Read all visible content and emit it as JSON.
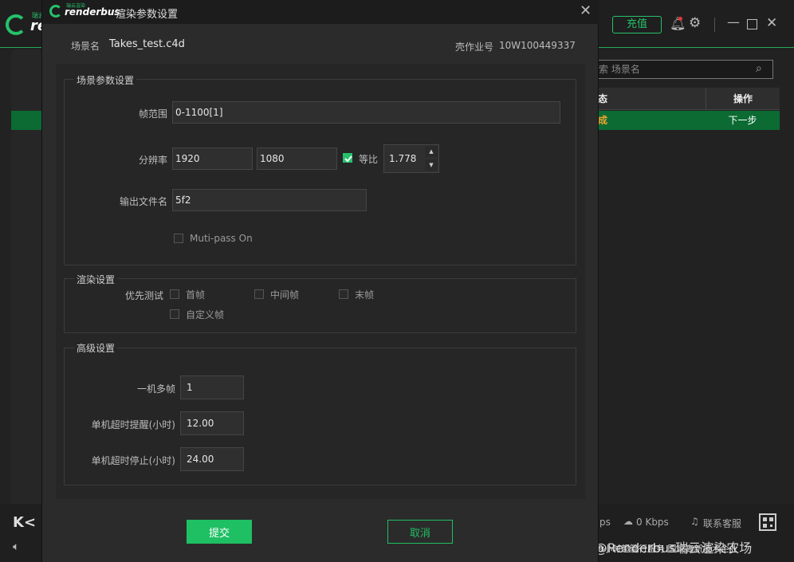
{
  "background_app": {
    "logo_small": "瑞云渲染",
    "logo_text": "re",
    "recharge_label": "充值",
    "search_placeholder": "索 场景名",
    "table_headers": [
      "态",
      "操作"
    ],
    "row": {
      "status": "成",
      "action": "下一步"
    },
    "status_bar": {
      "ps": "ps",
      "kbps": "0 Kbps",
      "support": "联系客服"
    },
    "footer_text": "9小时超管行服务 国家高新技术企业"
  },
  "watermark": "CSDN @Renderbus瑞云渲染农场",
  "dialog": {
    "brand_small": "瑞云渲染",
    "brand": "renderbus",
    "title": "渲染参数设置",
    "close_glyph": "✕",
    "scene_label": "场景名",
    "scene_name": "Takes_test.c4d",
    "job_label": "壳作业号",
    "job_value": "10W100449337",
    "scene_params": {
      "legend": "场景参数设置",
      "frame_range_label": "帧范围",
      "frame_range_value": "0-1100[1]",
      "resolution_label": "分辨率",
      "width": "1920",
      "height": "1080",
      "ratio_label": "等比",
      "ratio_checked": true,
      "ratio_value": "1.778",
      "output_label": "输出文件名",
      "output_value": "5f2",
      "multipass_label": "Muti-pass On",
      "multipass_checked": false
    },
    "render_settings": {
      "legend": "渲染设置",
      "priority_label": "优先测试",
      "options": [
        {
          "label": "首帧",
          "checked": false
        },
        {
          "label": "中间帧",
          "checked": false
        },
        {
          "label": "末帧",
          "checked": false
        },
        {
          "label": "自定义帧",
          "checked": false
        }
      ]
    },
    "advanced": {
      "legend": "高级设置",
      "multi_frame_label": "一机多帧",
      "multi_frame_value": "1",
      "timeout_warn_label": "单机超时提醒(小时)",
      "timeout_warn_value": "12.00",
      "timeout_stop_label": "单机超时停止(小时)",
      "timeout_stop_value": "24.00"
    },
    "submit_label": "提交",
    "cancel_label": "取消"
  }
}
